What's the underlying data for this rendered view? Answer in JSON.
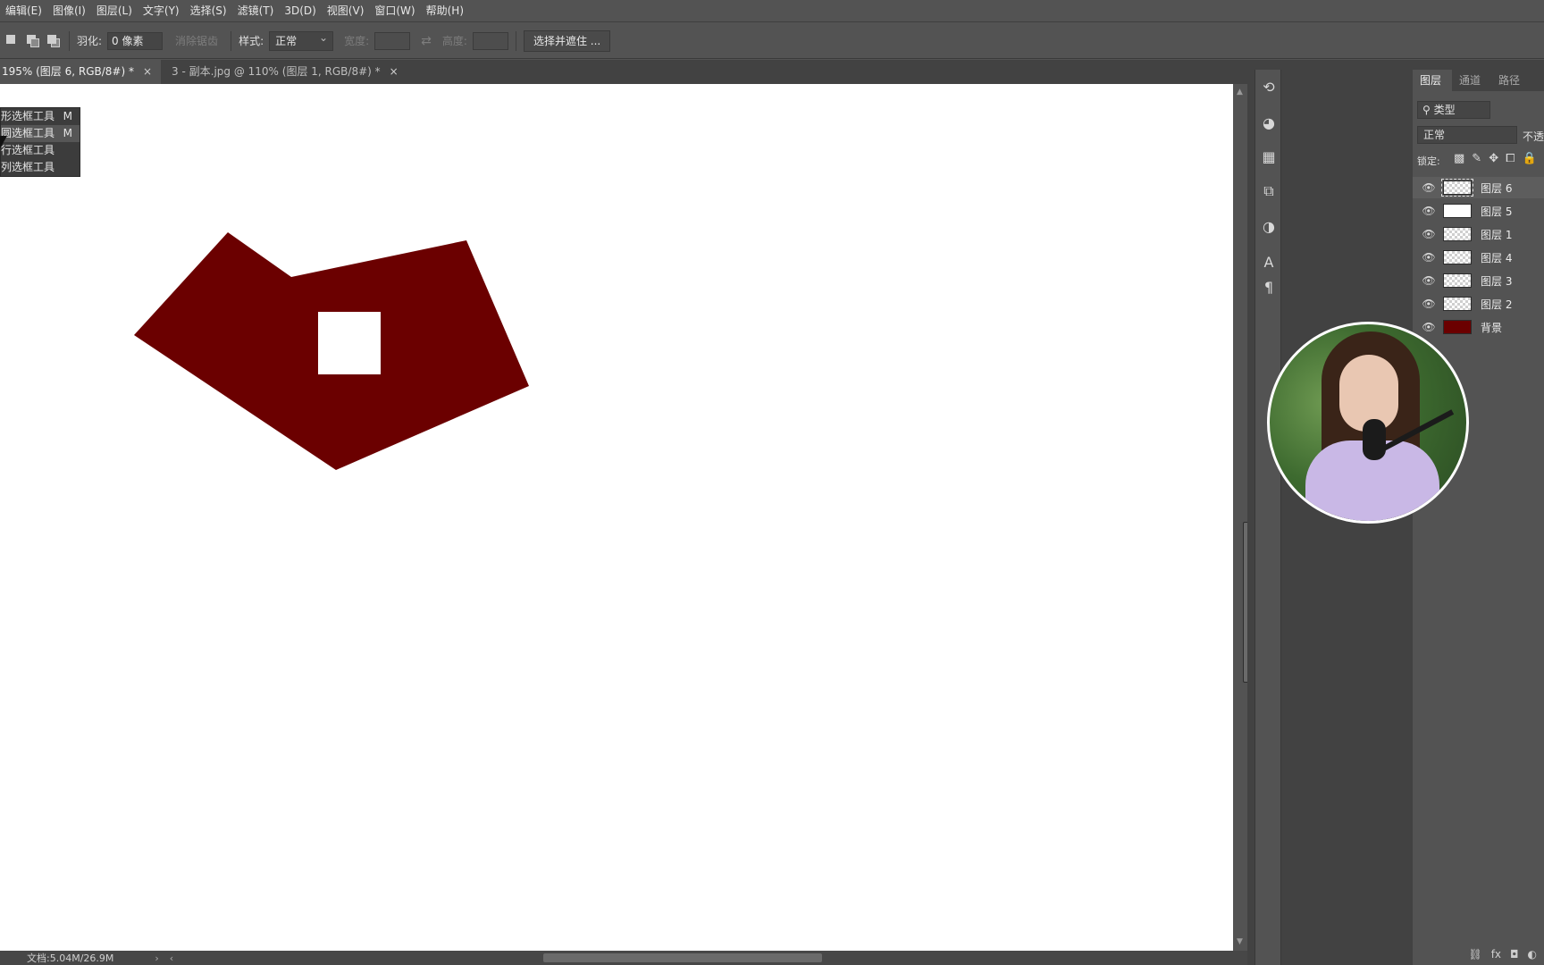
{
  "menubar": {
    "items": [
      "编辑(E)",
      "图像(I)",
      "图层(L)",
      "文字(Y)",
      "选择(S)",
      "滤镜(T)",
      "3D(D)",
      "视图(V)",
      "窗口(W)",
      "帮助(H)"
    ]
  },
  "options": {
    "feather_label": "羽化:",
    "feather_value": "0 像素",
    "antialias_label": "消除锯齿",
    "style_label": "样式:",
    "style_value": "正常",
    "width_label": "宽度:",
    "height_label": "高度:",
    "select_mask_button": "选择并遮住 ..."
  },
  "tabs": [
    {
      "label": "195% (图层 6, RGB/8#) *",
      "close": "×"
    },
    {
      "label": "3 - 副本.jpg @ 110% (图层 1, RGB/8#) *",
      "close": "×"
    }
  ],
  "flyout": {
    "items": [
      {
        "label": "形选框工具",
        "key": "M"
      },
      {
        "label": "圆选框工具",
        "key": "M"
      },
      {
        "label": "行选框工具",
        "key": ""
      },
      {
        "label": "列选框工具",
        "key": ""
      }
    ]
  },
  "canvas": {
    "shape_color": "#6b0000",
    "hole_color": "#ffffff"
  },
  "status": {
    "doc_info": "文档:5.04M/26.9M"
  },
  "layers_panel": {
    "tabs": [
      "图层",
      "通道",
      "路径"
    ],
    "filter": "类型",
    "blend_mode": "正常",
    "opacity_label": "不透",
    "lock_label": "锁定:",
    "layers": [
      {
        "name": "图层 6",
        "thumb": "transparent",
        "selected": true
      },
      {
        "name": "图层 5",
        "thumb": "white",
        "selected": false
      },
      {
        "name": "图层 1",
        "thumb": "transparent",
        "selected": false
      },
      {
        "name": "图层 4",
        "thumb": "transparent",
        "selected": false
      },
      {
        "name": "图层 3",
        "thumb": "transparent",
        "selected": false
      },
      {
        "name": "图层 2",
        "thumb": "transparent",
        "selected": false
      },
      {
        "name": "背景",
        "thumb": "dark",
        "selected": false
      }
    ]
  },
  "icons": {
    "history": "history-icon",
    "color": "palette-icon",
    "swatches": "grid-icon",
    "libraries": "libraries-icon",
    "adjust": "adjustments-icon",
    "character": "character-icon",
    "paragraph": "paragraph-icon"
  }
}
